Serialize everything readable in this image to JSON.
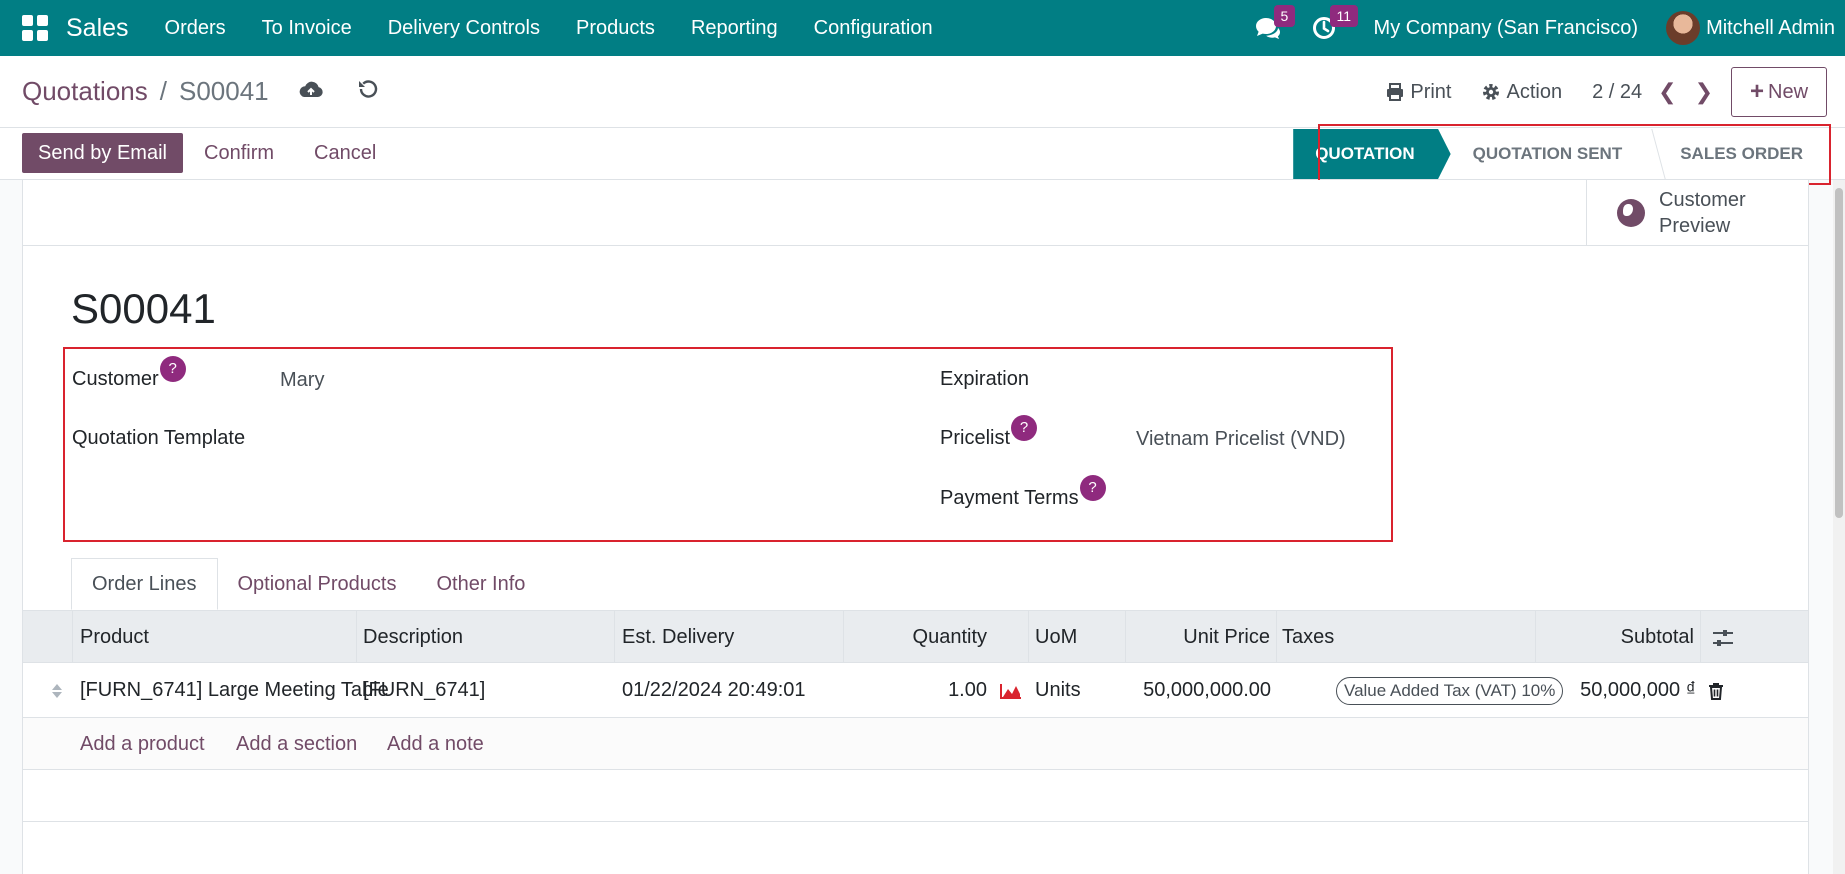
{
  "navbar": {
    "app_name": "Sales",
    "menu": [
      "Orders",
      "To Invoice",
      "Delivery Controls",
      "Products",
      "Reporting",
      "Configuration"
    ],
    "messages_count": "5",
    "activities_count": "11",
    "company": "My Company (San Francisco)",
    "user": "Mitchell Admin",
    "accent_color": "#017e84"
  },
  "control_panel": {
    "breadcrumb_parent": "Quotations",
    "breadcrumb_sep": "/",
    "breadcrumb_current": "S00041",
    "print_label": "Print",
    "action_label": "Action",
    "pager": "2 / 24",
    "new_label": "New"
  },
  "statusbar": {
    "send_email_label": "Send by Email",
    "confirm_label": "Confirm",
    "cancel_label": "Cancel",
    "stages": [
      "QUOTATION",
      "QUOTATION SENT",
      "SALES ORDER"
    ],
    "active_stage": "QUOTATION"
  },
  "sheet": {
    "customer_preview_label": "Customer Preview",
    "record_title": "S00041",
    "fields": {
      "customer_label": "Customer",
      "customer_value": "Mary",
      "template_label": "Quotation Template",
      "expiration_label": "Expiration",
      "pricelist_label": "Pricelist",
      "pricelist_value": "Vietnam Pricelist (VND)",
      "payment_terms_label": "Payment Terms",
      "help_mark": "?"
    },
    "tabs": [
      "Order Lines",
      "Optional Products",
      "Other Info"
    ],
    "table": {
      "headers": [
        "Product",
        "Description",
        "Est. Delivery",
        "Quantity",
        "UoM",
        "Unit Price",
        "Taxes",
        "Subtotal"
      ],
      "row": {
        "product": "[FURN_6741] Large Meeting Table",
        "description": "[FURN_6741]",
        "est_delivery": "01/22/2024 20:49:01",
        "quantity": "1.00",
        "uom": "Units",
        "unit_price": "50,000,000.00",
        "tax": "Value Added Tax (VAT) 10%",
        "subtotal": "50,000,000 ₫"
      },
      "add_links": [
        "Add a product",
        "Add a section",
        "Add a note"
      ]
    }
  }
}
